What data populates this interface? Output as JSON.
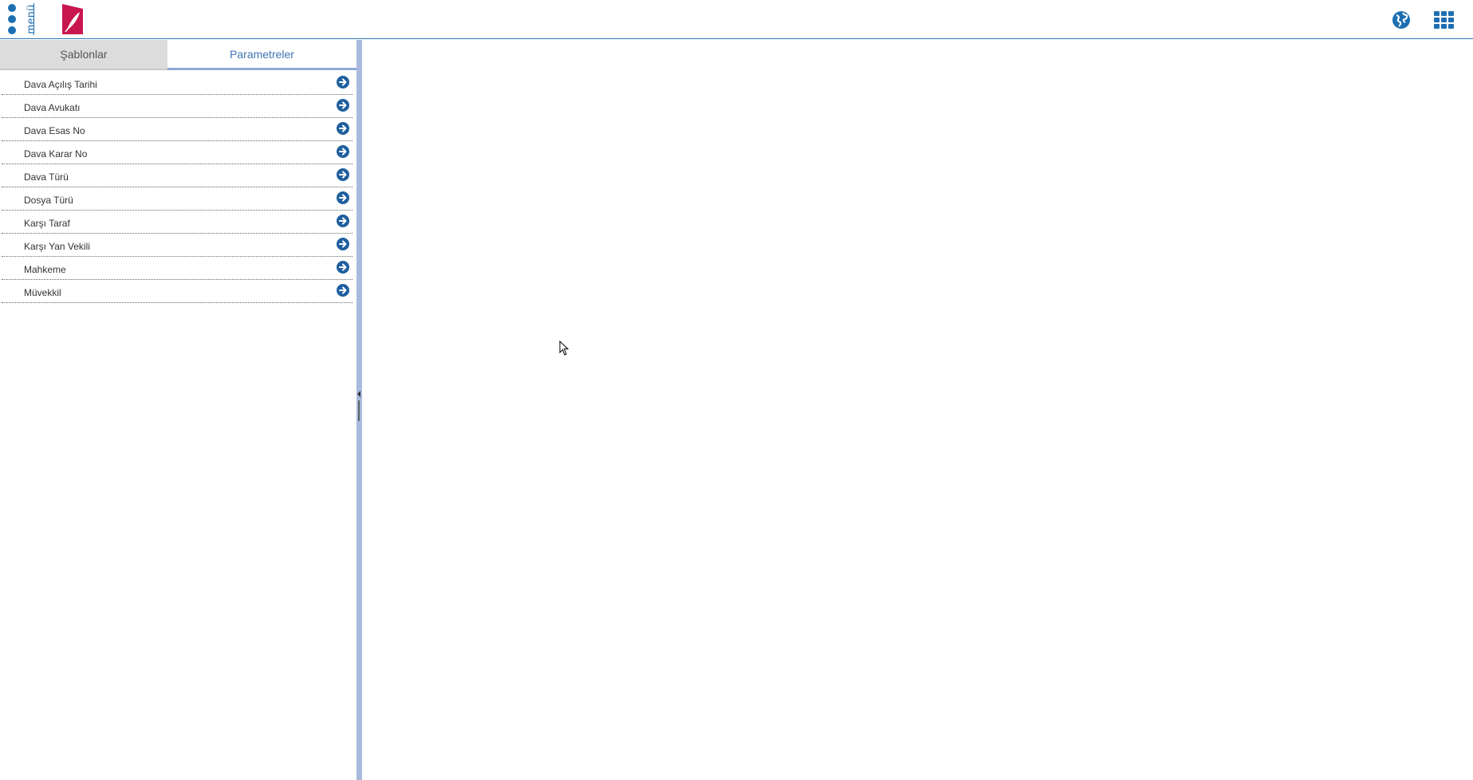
{
  "header": {
    "menu_label": "menü",
    "logo_icon": "feather-logo-icon",
    "globe_icon": "globe-icon",
    "apps_icon": "apps-grid-icon"
  },
  "tabs": [
    {
      "label": "Şablonlar",
      "active": false
    },
    {
      "label": "Parametreler",
      "active": true
    }
  ],
  "parameters": [
    {
      "label": "Dava Açılış Tarihi"
    },
    {
      "label": "Dava Avukatı"
    },
    {
      "label": "Dava Esas No"
    },
    {
      "label": "Dava Karar No"
    },
    {
      "label": "Dava Türü"
    },
    {
      "label": "Dosya Türü"
    },
    {
      "label": "Karşı Taraf"
    },
    {
      "label": "Karşı Yan Vekili"
    },
    {
      "label": "Mahkeme"
    },
    {
      "label": "Müvekkil"
    }
  ],
  "colors": {
    "accent": "#1d6fb2",
    "logo": "#c8174f",
    "splitter": "#aab9de",
    "active_tab_text": "#3f74b4"
  }
}
